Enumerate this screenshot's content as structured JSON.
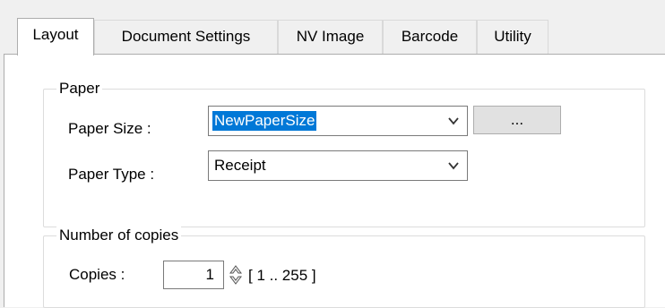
{
  "tabs": [
    {
      "label": "Layout",
      "active": true
    },
    {
      "label": "Document Settings",
      "active": false
    },
    {
      "label": "NV Image",
      "active": false
    },
    {
      "label": "Barcode",
      "active": false
    },
    {
      "label": "Utility",
      "active": false
    }
  ],
  "paper_group": {
    "title": "Paper",
    "paper_size": {
      "label": "Paper Size :",
      "value": "NewPaperSize",
      "selected": true,
      "browse_label": "..."
    },
    "paper_type": {
      "label": "Paper Type :",
      "value": "Receipt"
    }
  },
  "copies_group": {
    "title": "Number of copies",
    "copies_label": "Copies :",
    "copies_value": "1",
    "range_text": "[ 1 .. 255 ]"
  },
  "colors": {
    "selection": "#0078d7",
    "window_bg": "#f0f0f0",
    "panel_bg": "#ffffff"
  }
}
